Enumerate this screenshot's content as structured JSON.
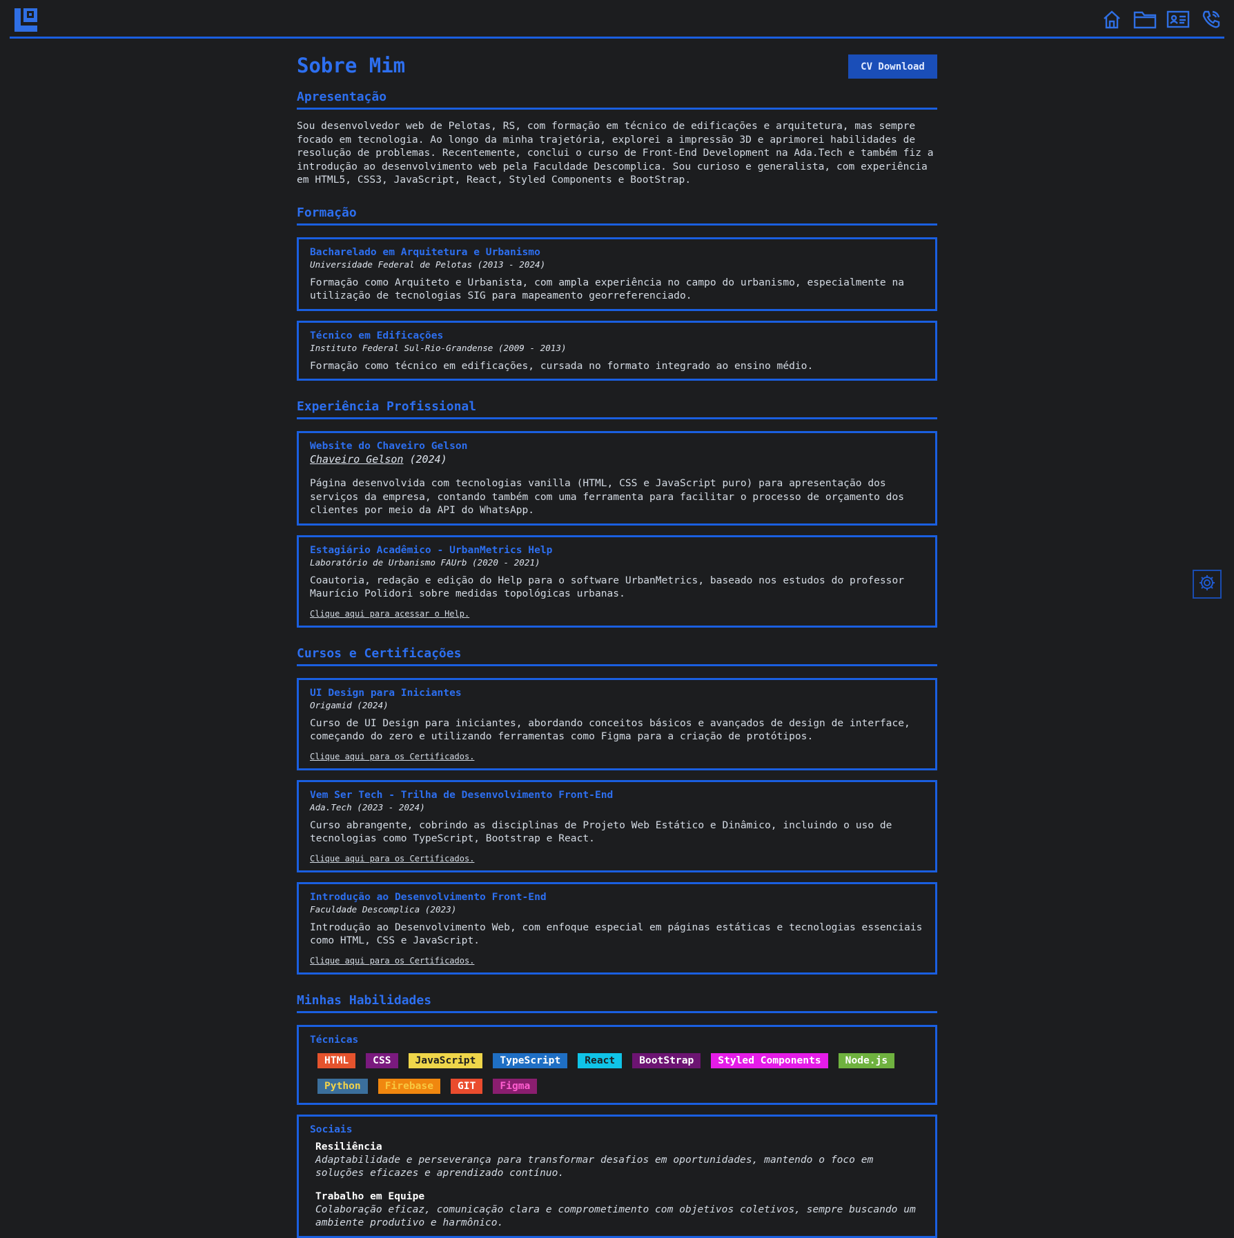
{
  "header": {
    "nav": [
      "home-icon",
      "folder-icon",
      "id-card-icon",
      "phone-icon"
    ]
  },
  "page": {
    "title": "Sobre Mim",
    "cv_button": "CV Download"
  },
  "apresentacao": {
    "title": "Apresentação",
    "text": "Sou desenvolvedor web de Pelotas, RS, com formação em técnico de edificações e arquitetura, mas sempre focado em tecnologia. Ao longo da minha trajetória, explorei a impressão 3D e aprimorei habilidades de resolução de problemas. Recentemente, conclui o curso de Front-End Development na Ada.Tech e também fiz a introdução ao desenvolvimento web pela Faculdade Descomplica. Sou curioso e generalista, com experiência em HTML5, CSS3, JavaScript, React, Styled Components e BootStrap."
  },
  "formacao": {
    "title": "Formação",
    "items": [
      {
        "title": "Bacharelado em Arquitetura e Urbanismo",
        "sub": "Universidade Federal de Pelotas (2013 - 2024)",
        "text": "Formação como Arquiteto e Urbanista, com ampla experiência no campo do urbanismo, especialmente na utilização de tecnologias SIG para mapeamento georreferenciado."
      },
      {
        "title": "Técnico em Edificações",
        "sub": "Instituto Federal Sul-Rio-Grandense (2009 - 2013)",
        "text": "Formação como técnico em edificações, cursada no formato integrado ao ensino médio."
      }
    ]
  },
  "experiencia": {
    "title": "Experiência Profissional",
    "items": [
      {
        "title": "Website do Chaveiro Gelson",
        "sub_link": "Chaveiro Gelson",
        "sub_rest": " (2024)",
        "text": "Página desenvolvida com tecnologias vanilla (HTML, CSS e JavaScript puro) para apresentação dos serviços da empresa, contando também com uma ferramenta para facilitar o processo de orçamento dos clientes por meio da API do WhatsApp."
      },
      {
        "title": "Estagiário Acadêmico - UrbanMetrics Help",
        "sub": "Laboratório de Urbanismo FAUrb (2020 - 2021)",
        "text": "Coautoria, redação e edição do Help para o software UrbanMetrics, baseado nos estudos do professor Maurício Polidori sobre medidas topológicas urbanas.",
        "link": "Clique aqui para acessar o Help."
      }
    ]
  },
  "cursos": {
    "title": "Cursos e Certificações",
    "items": [
      {
        "title": "UI Design para Iniciantes",
        "sub": "Origamid (2024)",
        "text": "Curso de UI Design para iniciantes, abordando conceitos básicos e avançados de design de interface, começando do zero e utilizando ferramentas como Figma para a criação de protótipos.",
        "link": "Clique aqui para os Certificados."
      },
      {
        "title": "Vem Ser Tech - Trilha de Desenvolvimento Front-End",
        "sub": "Ada.Tech (2023 - 2024)",
        "text": "Curso abrangente, cobrindo as disciplinas de Projeto Web Estático e Dinâmico, incluindo o uso de tecnologias como TypeScript, Bootstrap e React.",
        "link": "Clique aqui para os Certificados."
      },
      {
        "title": "Introdução ao Desenvolvimento Front-End",
        "sub": "Faculdade Descomplica (2023)",
        "text": "Introdução ao Desenvolvimento Web, com enfoque especial em páginas estáticas e tecnologias essenciais como HTML, CSS e JavaScript.",
        "link": "Clique aqui para os Certificados."
      }
    ]
  },
  "habilidades": {
    "title": "Minhas Habilidades",
    "tecnicas_title": "Técnicas",
    "tecnicas": [
      {
        "label": "HTML",
        "bg": "#e5532d",
        "fg": "#ffffff"
      },
      {
        "label": "CSS",
        "bg": "#7a1a7e",
        "fg": "#ffffff"
      },
      {
        "label": "JavaScript",
        "bg": "#efd64a",
        "fg": "#1c1d1f"
      },
      {
        "label": "TypeScript",
        "bg": "#1f6fc4",
        "fg": "#ffffff"
      },
      {
        "label": "React",
        "bg": "#10c4e8",
        "fg": "#1c1d1f"
      },
      {
        "label": "BootStrap",
        "bg": "#6c1472",
        "fg": "#ffffff"
      },
      {
        "label": "Styled Components",
        "bg": "#e51ce8",
        "fg": "#ffffff"
      },
      {
        "label": "Node.js",
        "bg": "#6fb23f",
        "fg": "#ffffff"
      },
      {
        "label": "Python",
        "bg": "#3b6f9c",
        "fg": "#f3d34a"
      },
      {
        "label": "Firebase",
        "bg": "#f0870f",
        "fg": "#f8c740"
      },
      {
        "label": "GIT",
        "bg": "#ea4c2e",
        "fg": "#ffffff"
      },
      {
        "label": "Figma",
        "bg": "#8a1e6f",
        "fg": "#ff5ed0"
      }
    ],
    "sociais_title": "Sociais",
    "sociais": [
      {
        "name": "Resiliência",
        "desc": "Adaptabilidade e perseverança para transformar desafios em oportunidades, mantendo o foco em soluções eficazes e aprendizado contínuo."
      },
      {
        "name": "Trabalho em Equipe",
        "desc": "Colaboração eficaz, comunicação clara e comprometimento com objetivos coletivos, sempre buscando um ambiente produtivo e harmônico."
      }
    ]
  }
}
